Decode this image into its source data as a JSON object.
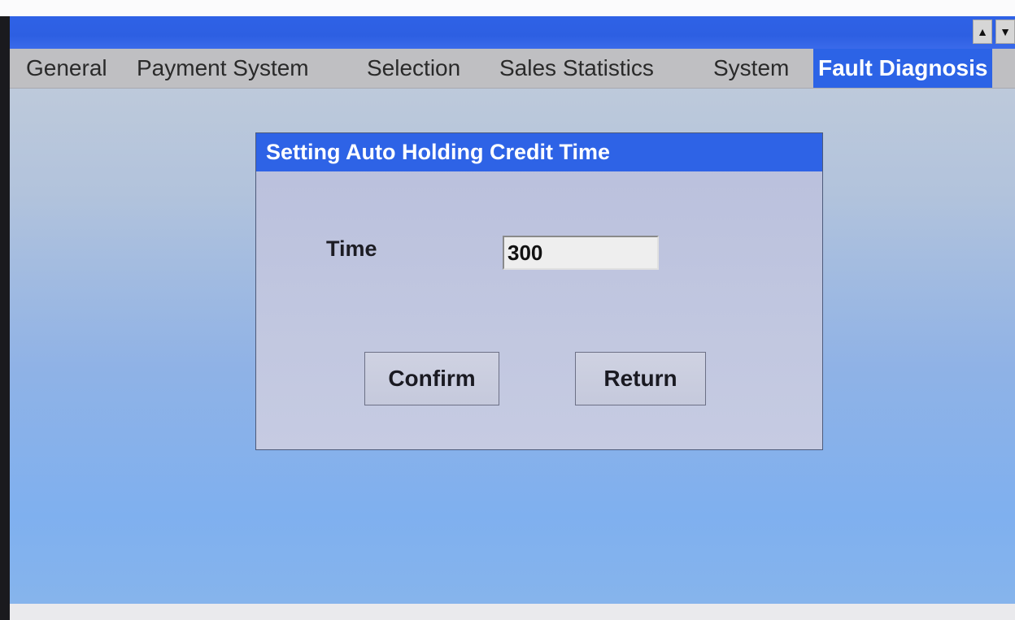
{
  "tabs": [
    {
      "label": "General",
      "active": false
    },
    {
      "label": "Payment System",
      "active": false
    },
    {
      "label": "Selection",
      "active": false
    },
    {
      "label": "Sales Statistics",
      "active": false
    },
    {
      "label": "System",
      "active": false
    },
    {
      "label": "Fault Diagnosis",
      "active": true
    }
  ],
  "scroll": {
    "up_icon": "▲",
    "down_icon": "▼"
  },
  "dialog": {
    "title": "Setting Auto Holding Credit Time",
    "field_label": "Time",
    "field_value": "300",
    "confirm_label": "Confirm",
    "return_label": "Return"
  },
  "colors": {
    "accent": "#2e63e6",
    "tab_bar": "#bfbfc2",
    "dialog_bg": "#c0c6df"
  }
}
